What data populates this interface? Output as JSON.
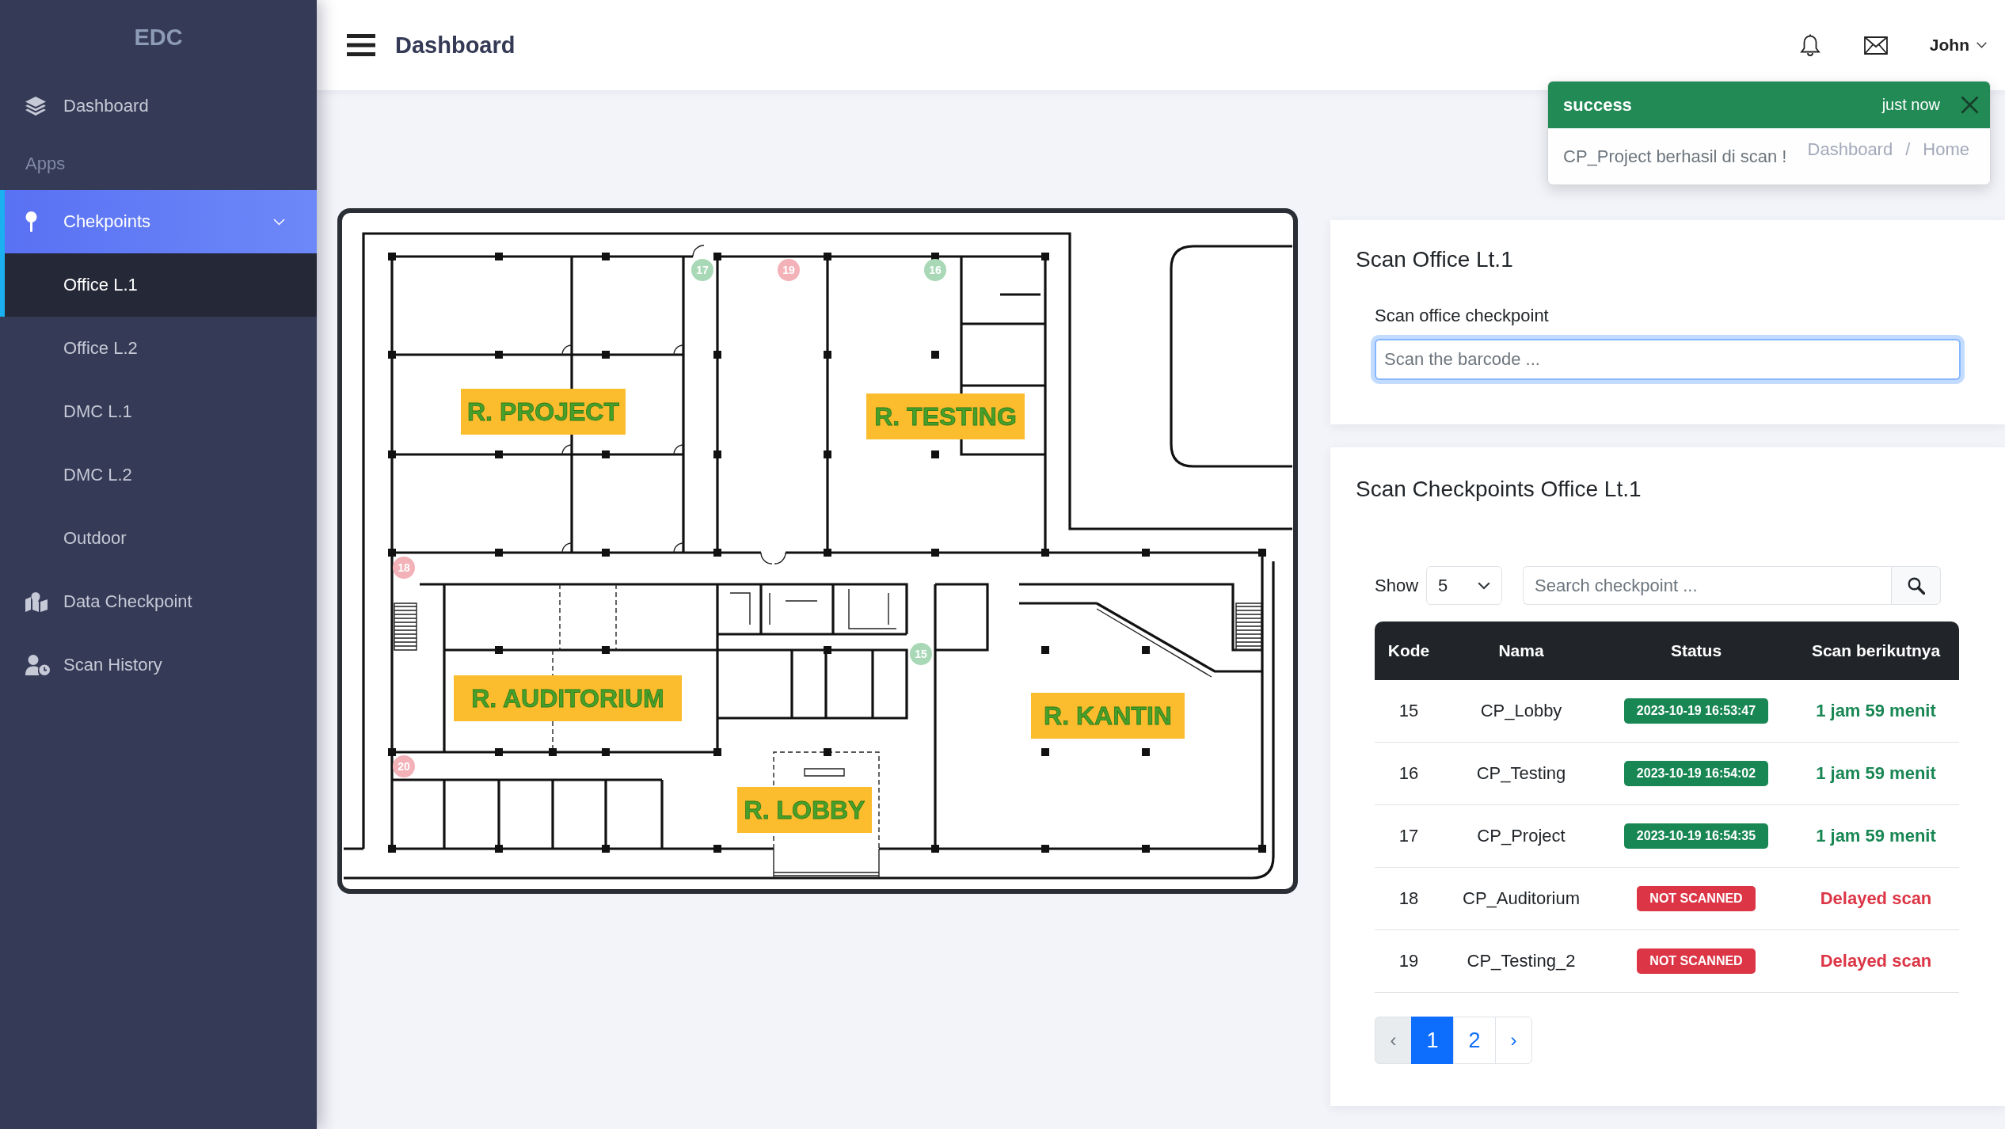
{
  "sidebar": {
    "brand": "EDC",
    "items": [
      {
        "kind": "link",
        "label": "Dashboard",
        "selected": false
      },
      {
        "kind": "heading",
        "label": "Apps"
      },
      {
        "kind": "group",
        "label": "Chekpoints",
        "selected": true,
        "expanded": true,
        "children": [
          {
            "label": "Office L.1",
            "selected": true
          },
          {
            "label": "Office L.2",
            "selected": false
          },
          {
            "label": "DMC L.1",
            "selected": false
          },
          {
            "label": "DMC L.2",
            "selected": false
          },
          {
            "label": "Outdoor",
            "selected": false
          }
        ]
      },
      {
        "kind": "link",
        "label": "Data Checkpoint",
        "selected": false
      },
      {
        "kind": "link",
        "label": "Scan History",
        "selected": false
      }
    ]
  },
  "topbar": {
    "title": "Dashboard",
    "user": "John"
  },
  "breadcrumb": {
    "items": [
      "Dashboard",
      "Home"
    ],
    "separator": "/"
  },
  "toast": {
    "kind": "success",
    "title": "success",
    "time": "just now",
    "message": "CP_Project berhasil di scan !"
  },
  "floor_plan": {
    "rooms": [
      {
        "label": "R. PROJECT"
      },
      {
        "label": "R. TESTING"
      },
      {
        "label": "R. AUDITORIUM"
      },
      {
        "label": "R. KANTIN"
      },
      {
        "label": "R. LOBBY"
      }
    ],
    "markers": [
      {
        "label": "17",
        "color": "#a8d8b6"
      },
      {
        "label": "19",
        "color": "#f3b1b8"
      },
      {
        "label": "16",
        "color": "#a8d8b6"
      },
      {
        "label": "18",
        "color": "#f3b1b8"
      },
      {
        "label": "15",
        "color": "#a8d8b6"
      },
      {
        "label": "20",
        "color": "#f3b1b8"
      }
    ]
  },
  "scan_card": {
    "title": "Scan Office Lt.1",
    "field": {
      "label": "Scan office checkpoint",
      "placeholder": "Scan the barcode ...",
      "focused": true
    }
  },
  "checkpoints_card": {
    "title": "Scan Checkpoints Office Lt.1",
    "show": {
      "label": "Show",
      "value": "5"
    },
    "search": {
      "placeholder": "Search checkpoint ..."
    },
    "table": {
      "columns": [
        "Kode",
        "Nama",
        "Status",
        "Scan berikutnya"
      ],
      "rows": [
        {
          "kode": "15",
          "nama": "CP_Lobby",
          "status": "2023-10-19 16:53:47",
          "scanned": true,
          "next": "1 jam 59 menit"
        },
        {
          "kode": "16",
          "nama": "CP_Testing",
          "status": "2023-10-19 16:54:02",
          "scanned": true,
          "next": "1 jam 59 menit"
        },
        {
          "kode": "17",
          "nama": "CP_Project",
          "status": "2023-10-19 16:54:35",
          "scanned": true,
          "next": "1 jam 59 menit"
        },
        {
          "kode": "18",
          "nama": "CP_Auditorium",
          "status": "NOT SCANNED",
          "scanned": false,
          "next": "Delayed scan"
        },
        {
          "kode": "19",
          "nama": "CP_Testing_2",
          "status": "NOT SCANNED",
          "scanned": false,
          "next": "Delayed scan"
        }
      ]
    },
    "pagination": {
      "prev": {
        "label": "‹",
        "disabled": true
      },
      "pages": [
        {
          "label": "1",
          "selected": true
        },
        {
          "label": "2",
          "selected": false
        }
      ],
      "next": {
        "label": "›",
        "disabled": false
      }
    }
  }
}
